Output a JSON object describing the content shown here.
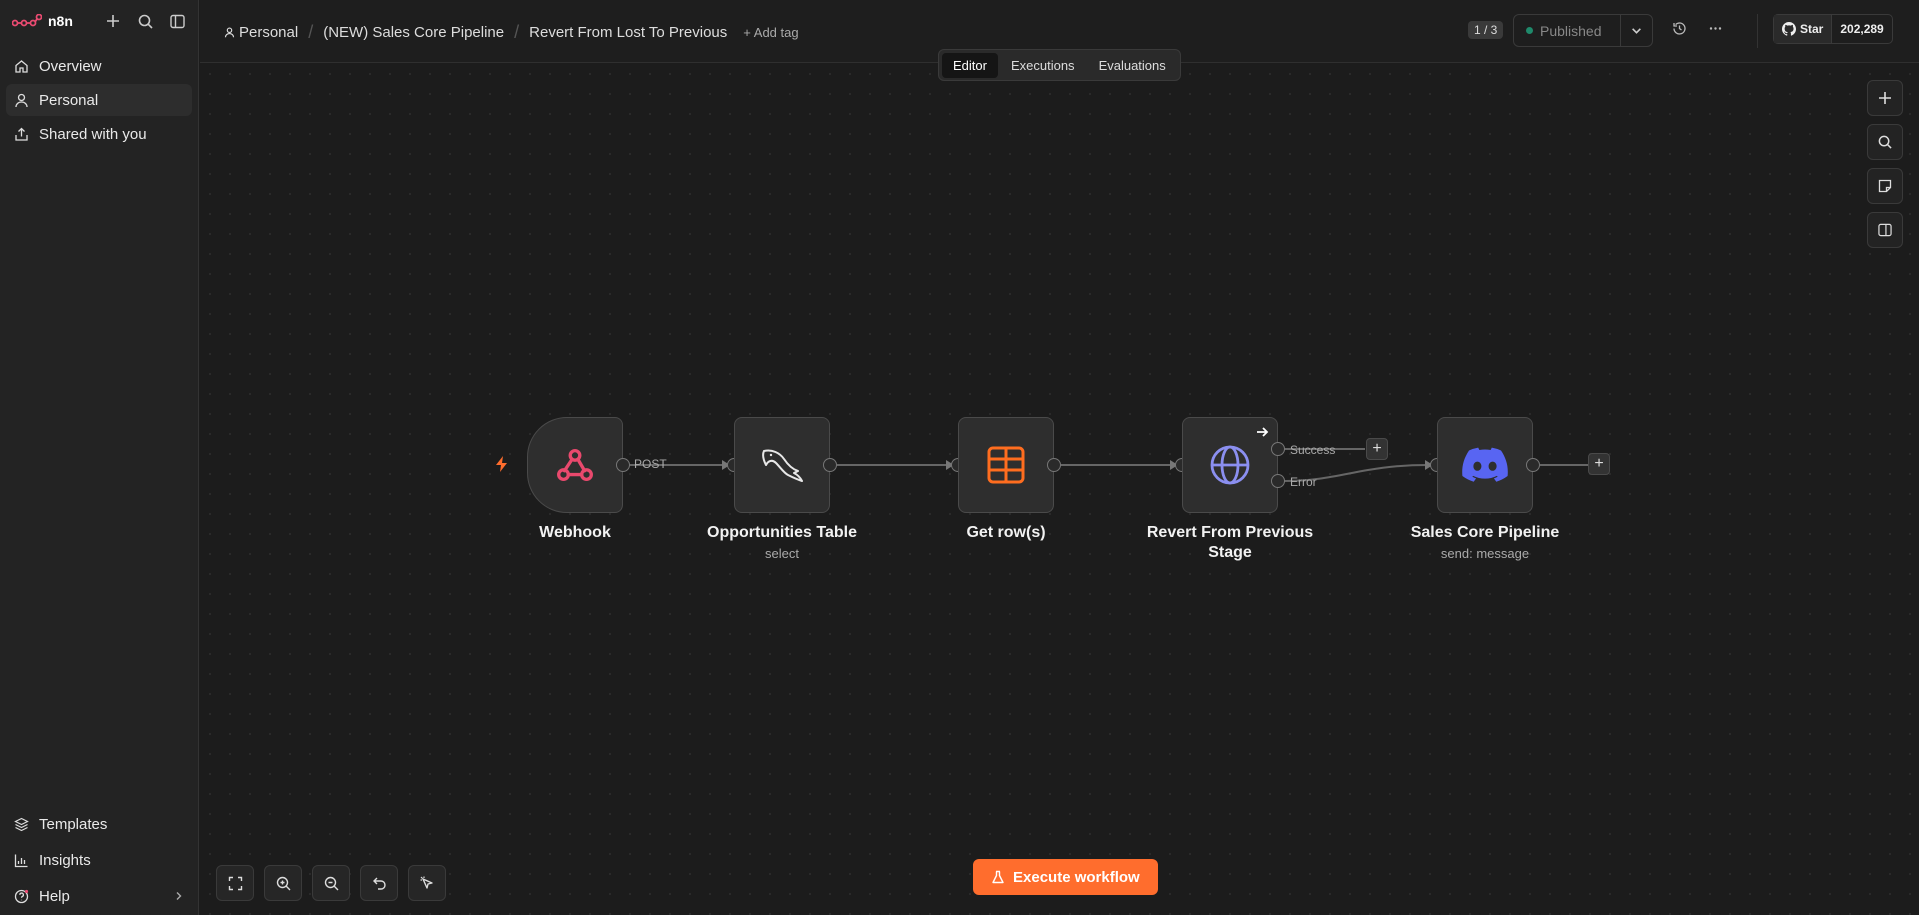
{
  "app": {
    "name": "n8n"
  },
  "sidebar": {
    "items": [
      {
        "label": "Overview",
        "icon": "home-icon"
      },
      {
        "label": "Personal",
        "icon": "user-icon",
        "active": true
      },
      {
        "label": "Shared with you",
        "icon": "share-icon"
      }
    ],
    "bottom_items": [
      {
        "label": "Templates",
        "icon": "templates-icon"
      },
      {
        "label": "Insights",
        "icon": "insights-icon"
      },
      {
        "label": "Help",
        "icon": "help-icon"
      }
    ]
  },
  "header": {
    "breadcrumbs": [
      "Personal",
      "(NEW) Sales Core Pipeline",
      "Revert From Lost To Previous"
    ],
    "add_tag": "+ Add tag",
    "version": "1 / 3",
    "publish_status": "Published",
    "github_star": "Star",
    "github_count": "202,289"
  },
  "tabs": [
    "Editor",
    "Executions",
    "Evaluations"
  ],
  "nodes": [
    {
      "name": "Webhook",
      "sub": "",
      "icon": "webhook-icon"
    },
    {
      "name": "Opportunities Table",
      "sub": "select",
      "icon": "mysql-icon"
    },
    {
      "name": "Get row(s)",
      "sub": "",
      "icon": "table-icon"
    },
    {
      "name": "Revert From Previous Stage",
      "sub": "",
      "icon": "globe-icon"
    },
    {
      "name": "Sales Core Pipeline",
      "sub": "send: message",
      "icon": "discord-icon"
    }
  ],
  "edges": {
    "webhook_method": "POST",
    "success": "Success",
    "error": "Error"
  },
  "execute_button": "Execute workflow",
  "colors": {
    "accent": "#ff6d2d",
    "webhook": "#e9496d",
    "table": "#ff6d1f",
    "globe": "#8b8ff0",
    "discord": "#5865f2"
  }
}
